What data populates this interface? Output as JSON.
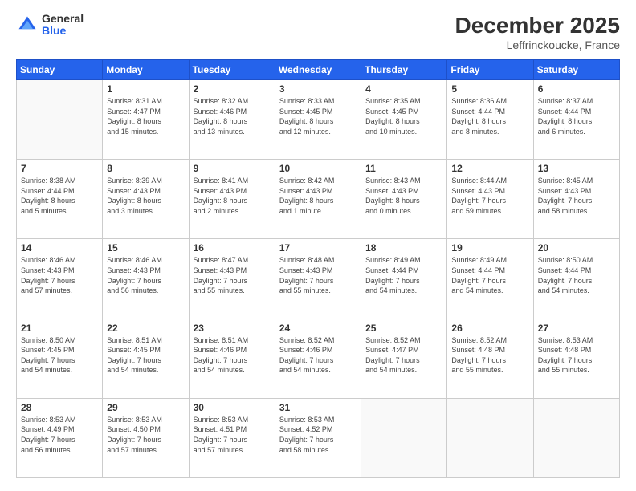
{
  "header": {
    "logo_general": "General",
    "logo_blue": "Blue",
    "month_title": "December 2025",
    "location": "Leffrinckoucke, France"
  },
  "weekdays": [
    "Sunday",
    "Monday",
    "Tuesday",
    "Wednesday",
    "Thursday",
    "Friday",
    "Saturday"
  ],
  "weeks": [
    [
      {
        "day": "",
        "info": ""
      },
      {
        "day": "1",
        "info": "Sunrise: 8:31 AM\nSunset: 4:47 PM\nDaylight: 8 hours\nand 15 minutes."
      },
      {
        "day": "2",
        "info": "Sunrise: 8:32 AM\nSunset: 4:46 PM\nDaylight: 8 hours\nand 13 minutes."
      },
      {
        "day": "3",
        "info": "Sunrise: 8:33 AM\nSunset: 4:45 PM\nDaylight: 8 hours\nand 12 minutes."
      },
      {
        "day": "4",
        "info": "Sunrise: 8:35 AM\nSunset: 4:45 PM\nDaylight: 8 hours\nand 10 minutes."
      },
      {
        "day": "5",
        "info": "Sunrise: 8:36 AM\nSunset: 4:44 PM\nDaylight: 8 hours\nand 8 minutes."
      },
      {
        "day": "6",
        "info": "Sunrise: 8:37 AM\nSunset: 4:44 PM\nDaylight: 8 hours\nand 6 minutes."
      }
    ],
    [
      {
        "day": "7",
        "info": "Sunrise: 8:38 AM\nSunset: 4:44 PM\nDaylight: 8 hours\nand 5 minutes."
      },
      {
        "day": "8",
        "info": "Sunrise: 8:39 AM\nSunset: 4:43 PM\nDaylight: 8 hours\nand 3 minutes."
      },
      {
        "day": "9",
        "info": "Sunrise: 8:41 AM\nSunset: 4:43 PM\nDaylight: 8 hours\nand 2 minutes."
      },
      {
        "day": "10",
        "info": "Sunrise: 8:42 AM\nSunset: 4:43 PM\nDaylight: 8 hours\nand 1 minute."
      },
      {
        "day": "11",
        "info": "Sunrise: 8:43 AM\nSunset: 4:43 PM\nDaylight: 8 hours\nand 0 minutes."
      },
      {
        "day": "12",
        "info": "Sunrise: 8:44 AM\nSunset: 4:43 PM\nDaylight: 7 hours\nand 59 minutes."
      },
      {
        "day": "13",
        "info": "Sunrise: 8:45 AM\nSunset: 4:43 PM\nDaylight: 7 hours\nand 58 minutes."
      }
    ],
    [
      {
        "day": "14",
        "info": "Sunrise: 8:46 AM\nSunset: 4:43 PM\nDaylight: 7 hours\nand 57 minutes."
      },
      {
        "day": "15",
        "info": "Sunrise: 8:46 AM\nSunset: 4:43 PM\nDaylight: 7 hours\nand 56 minutes."
      },
      {
        "day": "16",
        "info": "Sunrise: 8:47 AM\nSunset: 4:43 PM\nDaylight: 7 hours\nand 55 minutes."
      },
      {
        "day": "17",
        "info": "Sunrise: 8:48 AM\nSunset: 4:43 PM\nDaylight: 7 hours\nand 55 minutes."
      },
      {
        "day": "18",
        "info": "Sunrise: 8:49 AM\nSunset: 4:44 PM\nDaylight: 7 hours\nand 54 minutes."
      },
      {
        "day": "19",
        "info": "Sunrise: 8:49 AM\nSunset: 4:44 PM\nDaylight: 7 hours\nand 54 minutes."
      },
      {
        "day": "20",
        "info": "Sunrise: 8:50 AM\nSunset: 4:44 PM\nDaylight: 7 hours\nand 54 minutes."
      }
    ],
    [
      {
        "day": "21",
        "info": "Sunrise: 8:50 AM\nSunset: 4:45 PM\nDaylight: 7 hours\nand 54 minutes."
      },
      {
        "day": "22",
        "info": "Sunrise: 8:51 AM\nSunset: 4:45 PM\nDaylight: 7 hours\nand 54 minutes."
      },
      {
        "day": "23",
        "info": "Sunrise: 8:51 AM\nSunset: 4:46 PM\nDaylight: 7 hours\nand 54 minutes."
      },
      {
        "day": "24",
        "info": "Sunrise: 8:52 AM\nSunset: 4:46 PM\nDaylight: 7 hours\nand 54 minutes."
      },
      {
        "day": "25",
        "info": "Sunrise: 8:52 AM\nSunset: 4:47 PM\nDaylight: 7 hours\nand 54 minutes."
      },
      {
        "day": "26",
        "info": "Sunrise: 8:52 AM\nSunset: 4:48 PM\nDaylight: 7 hours\nand 55 minutes."
      },
      {
        "day": "27",
        "info": "Sunrise: 8:53 AM\nSunset: 4:48 PM\nDaylight: 7 hours\nand 55 minutes."
      }
    ],
    [
      {
        "day": "28",
        "info": "Sunrise: 8:53 AM\nSunset: 4:49 PM\nDaylight: 7 hours\nand 56 minutes."
      },
      {
        "day": "29",
        "info": "Sunrise: 8:53 AM\nSunset: 4:50 PM\nDaylight: 7 hours\nand 57 minutes."
      },
      {
        "day": "30",
        "info": "Sunrise: 8:53 AM\nSunset: 4:51 PM\nDaylight: 7 hours\nand 57 minutes."
      },
      {
        "day": "31",
        "info": "Sunrise: 8:53 AM\nSunset: 4:52 PM\nDaylight: 7 hours\nand 58 minutes."
      },
      {
        "day": "",
        "info": ""
      },
      {
        "day": "",
        "info": ""
      },
      {
        "day": "",
        "info": ""
      }
    ]
  ]
}
